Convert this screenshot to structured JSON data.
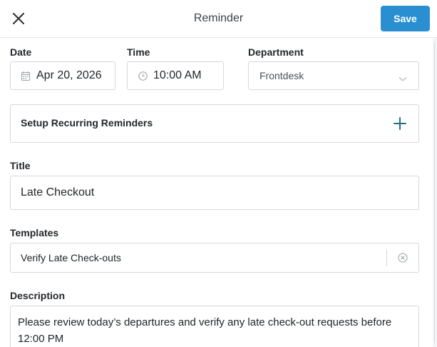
{
  "header": {
    "title": "Reminder",
    "save_label": "Save",
    "close_icon": "close-icon"
  },
  "form": {
    "date": {
      "label": "Date",
      "value": "Apr 20, 2026",
      "icon": "calendar-icon"
    },
    "time": {
      "label": "Time",
      "value": "10:00 AM",
      "icon": "clock-icon"
    },
    "department": {
      "label": "Department",
      "value": "Frontdesk",
      "icon": "chevron-down-icon"
    },
    "recurring": {
      "label": "Setup Recurring Reminders",
      "icon": "plus-icon"
    },
    "title": {
      "label": "Title",
      "value": "Late Checkout"
    },
    "templates": {
      "label": "Templates",
      "value": "Verify Late Check-outs",
      "icon": "clear-icon"
    },
    "description": {
      "label": "Description",
      "value": "Please review today’s departures and verify any late check-out requests before 12:00 PM"
    }
  },
  "colors": {
    "accent": "#2a8fd1",
    "border": "#d4d7db",
    "plus": "#1f6f8b"
  }
}
